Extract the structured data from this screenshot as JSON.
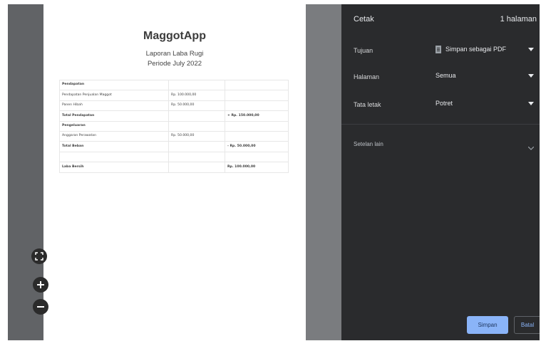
{
  "preview": {
    "document": {
      "app_name": "MaggotApp",
      "report_title": "Laporan Laba Rugi",
      "period": "Periode July 2022",
      "rows": [
        {
          "label": "Pendapatan",
          "sub": "",
          "total": "",
          "bold": true
        },
        {
          "label": "Pendapatan Penjualan Maggot",
          "sub": "Rp. 100.000,00",
          "total": "",
          "bold": false
        },
        {
          "label": "Panen Hibah",
          "sub": "Rp. 50.000,00",
          "total": "",
          "bold": false
        },
        {
          "label": "Total Pendapatan",
          "sub": "",
          "total": "+ Rp. 150.000,00",
          "bold": true
        },
        {
          "label": "Pengeluaran",
          "sub": "",
          "total": "",
          "bold": true
        },
        {
          "label": "Anggaran Perawatan",
          "sub": "Rp. 50.000,00",
          "total": "",
          "bold": false
        },
        {
          "label": "Total Beban",
          "sub": "",
          "total": "- Rp. 50.000,00",
          "bold": true
        },
        {
          "label": "",
          "sub": "",
          "total": "",
          "bold": false
        },
        {
          "label": "Laba Bersih",
          "sub": "",
          "total": "Rp. 100.000,00",
          "bold": true
        }
      ]
    },
    "zoom_controls": {
      "fit_icon": "fit-to-page-icon",
      "zoom_in_icon": "zoom-in-icon",
      "zoom_out_icon": "zoom-out-icon"
    }
  },
  "panel": {
    "title": "Cetak",
    "page_count": "1 halaman",
    "destination": {
      "label": "Tujuan",
      "value": "Simpan sebagai PDF",
      "icon": "pdf-file-icon"
    },
    "pages": {
      "label": "Halaman",
      "value": "Semua"
    },
    "layout": {
      "label": "Tata letak",
      "value": "Potret"
    },
    "more_settings": {
      "label": "Setelan lain"
    },
    "save_button": "Simpan",
    "cancel_button": "Batal"
  },
  "colors": {
    "panel_bg": "#2a2b2d",
    "preview_bg": "#616366",
    "accent": "#8ab4f8"
  }
}
